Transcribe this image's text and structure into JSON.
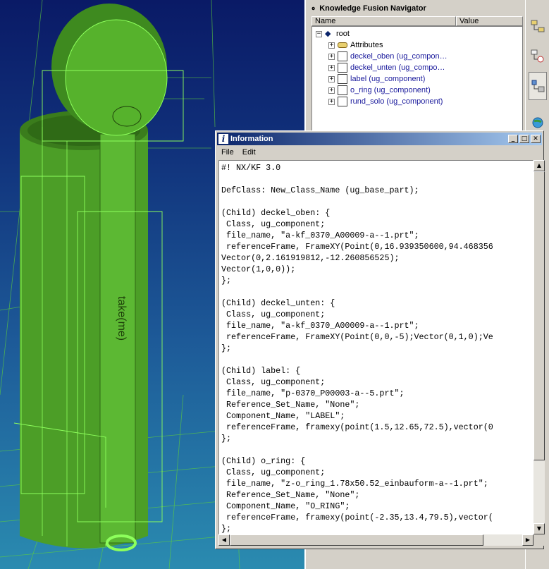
{
  "navigator": {
    "title": "Knowledge Fusion Navigator",
    "columns": [
      "Name",
      "Value"
    ],
    "root_label": "root",
    "items": [
      {
        "label": "Attributes",
        "icon": "attributes-icon"
      },
      {
        "label": "deckel_oben (ug_compon…",
        "icon": "component-icon"
      },
      {
        "label": "deckel_unten (ug_compo…",
        "icon": "component-icon"
      },
      {
        "label": "label (ug_component)",
        "icon": "component-icon"
      },
      {
        "label": "o_ring (ug_component)",
        "icon": "component-icon"
      },
      {
        "label": "rund_solo (ug_component)",
        "icon": "component-icon"
      }
    ]
  },
  "info_window": {
    "title": "Information",
    "menu": [
      "File",
      "Edit"
    ],
    "content": "#! NX/KF 3.0\n\nDefClass: New_Class_Name (ug_base_part);\n\n(Child) deckel_oben: {\n Class, ug_component;\n file_name, \"a-kf_0370_A00009-a--1.prt\";\n referenceFrame, FrameXY(Point(0,16.939350600,94.468356\nVector(0,2.161919812,-12.260856525);\nVector(1,0,0));\n};\n\n(Child) deckel_unten: {\n Class, ug_component;\n file_name, \"a-kf_0370_A00009-a--1.prt\";\n referenceFrame, FrameXY(Point(0,0,-5);Vector(0,1,0);Ve\n};\n\n(Child) label: {\n Class, ug_component;\n file_name, \"p-0370_P00003-a--5.prt\";\n Reference_Set_Name, \"None\";\n Component_Name, \"LABEL\";\n referenceFrame, framexy(point(1.5,12.65,72.5),vector(0\n};\n\n(Child) o_ring: {\n Class, ug_component;\n file_name, \"z-o_ring_1.78x50.52_einbauform-a--1.prt\";\n Reference_Set_Name, \"None\";\n Component_Name, \"O_RING\";\n referenceFrame, framexy(point(-2.35,13.4,79.5),vector(\n};"
  },
  "model_label_text": "take(me)",
  "colors": {
    "model_green": "#4fa82a",
    "wire_green": "#7dff4a",
    "title_bar": "#0a246a",
    "panel": "#d4d0c8"
  }
}
